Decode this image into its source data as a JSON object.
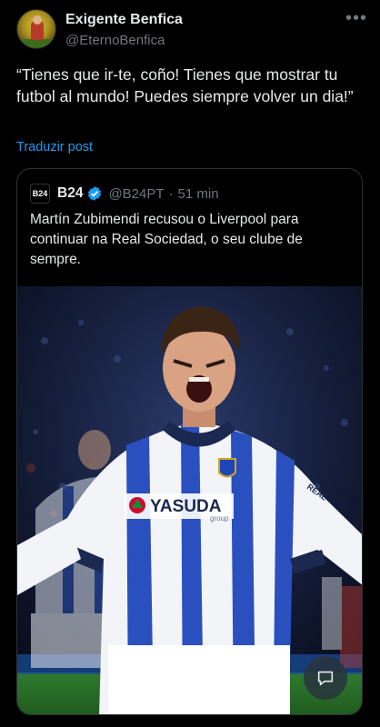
{
  "post": {
    "display_name": "Exigente Benfica",
    "handle": "@EternoBenfica",
    "more_icon": "more-horizontal-icon",
    "text": "“Tienes que ir-te, coño! Tienes que mostrar tu futbol al mundo! Puedes siempre volver un dia!”",
    "translate_label": "Traduzir post"
  },
  "quoted": {
    "logo_text": "B24",
    "name": "B24",
    "handle": "@B24PT",
    "separator": "·",
    "time": "51 min",
    "text": "Martín Zubimendi recusou o Liverpool para continuar na Real Sociedad, o seu clube de sempre.",
    "image": {
      "sponsor": "YASUDA",
      "sponsor_sub": "group",
      "sleeve_text": "REAL"
    }
  },
  "colors": {
    "accent": "#1d9bf0",
    "background": "#000000",
    "muted": "#71767b",
    "text": "#e7e9ea"
  }
}
